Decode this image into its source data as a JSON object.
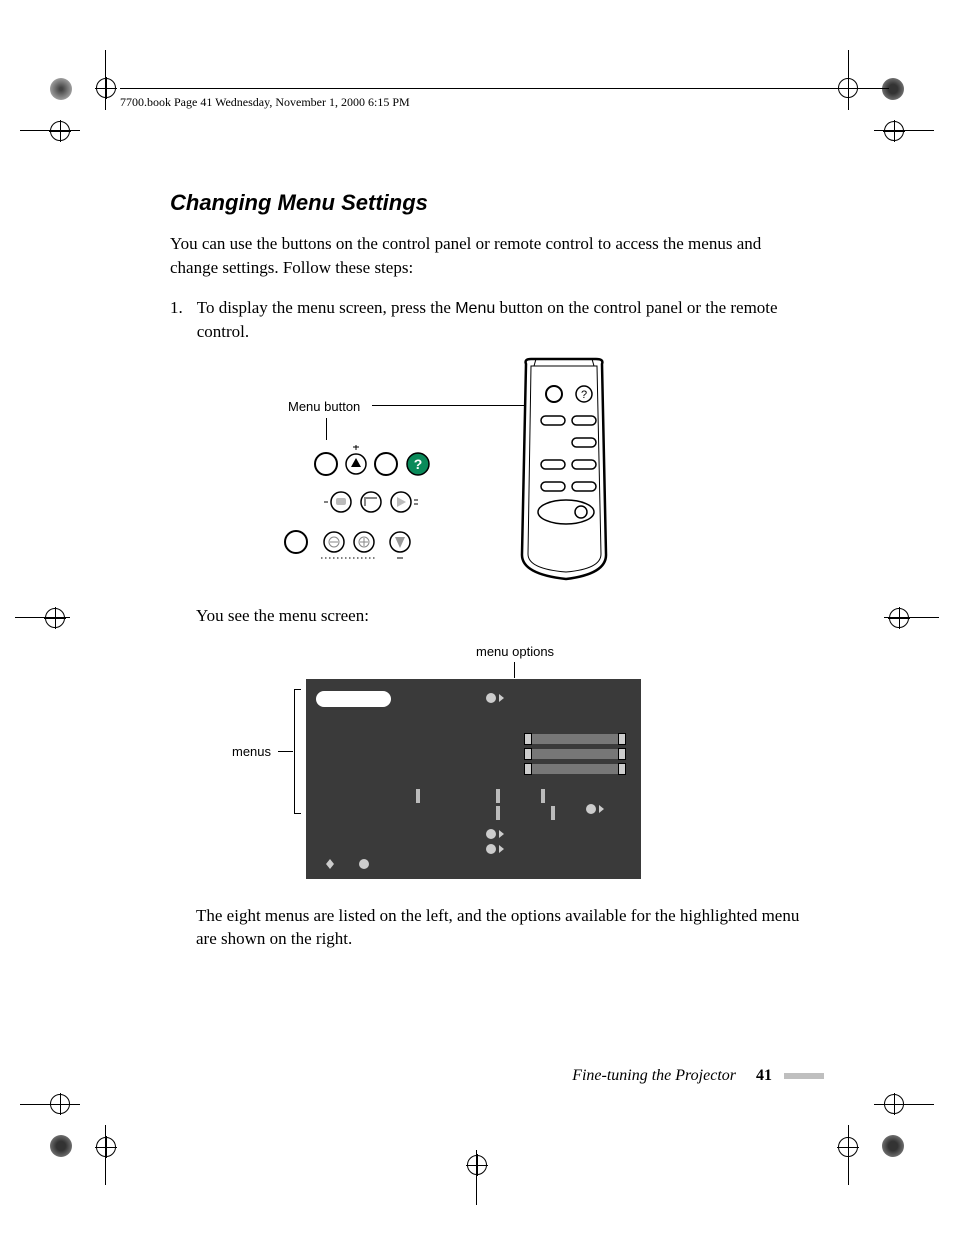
{
  "header": "7700.book  Page 41  Wednesday, November 1, 2000  6:15 PM",
  "title": "Changing Menu Settings",
  "intro": "You can use the buttons on the control panel or remote control to access the menus and change settings. Follow these steps:",
  "step1_num": "1.",
  "step1_a": "To display the menu screen, press the ",
  "step1_b": "Menu",
  "step1_c": " button on the control panel or the remote control.",
  "label_menu_button": "Menu button",
  "after_fig": "You see the menu screen:",
  "label_menu_options": "menu options",
  "label_menus": "menus",
  "closing": "The eight menus are listed on the left, and the options available for the highlighted menu are shown on the right.",
  "footer_title": "Fine-tuning the Projector",
  "footer_page": "41"
}
